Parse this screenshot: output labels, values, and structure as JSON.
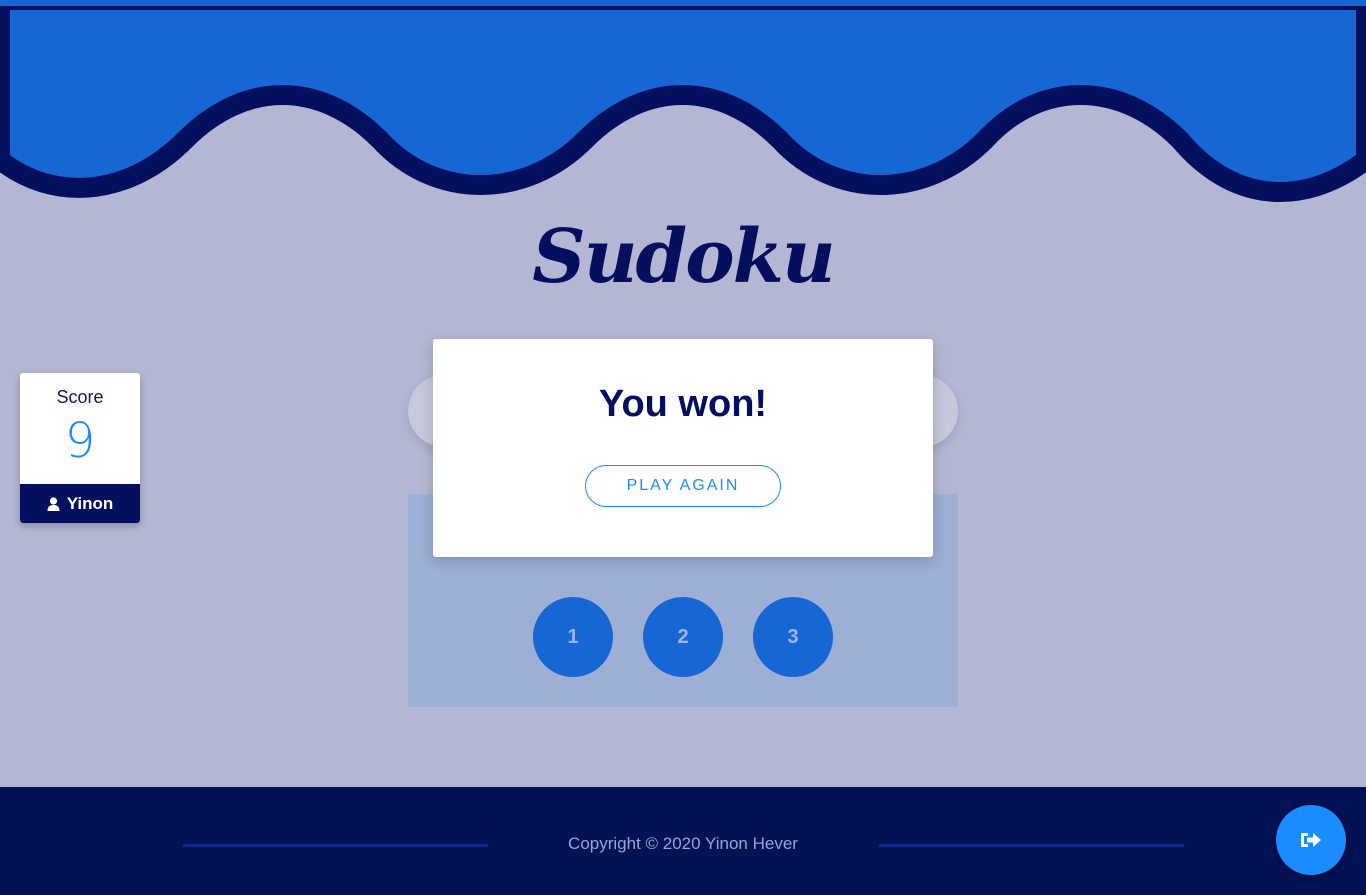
{
  "app": {
    "title": "Sudoku"
  },
  "score_card": {
    "label": "Score",
    "value": "9",
    "player_name": "Yinon",
    "player_icon": "user-icon"
  },
  "modal": {
    "title": "You won!",
    "play_again_label": "PLAY AGAIN"
  },
  "number_pad": {
    "buttons": [
      "1",
      "2",
      "3"
    ]
  },
  "footer": {
    "copyright": "Copyright © 2020 Yinon Hever"
  },
  "logout": {
    "icon": "logout-icon"
  },
  "colors": {
    "background": "#b3b7d3",
    "wave_blue": "#1667d3",
    "navy": "#04105e",
    "accent": "#1a8cff",
    "panel": "#9dafd5",
    "footer": "#031155"
  }
}
